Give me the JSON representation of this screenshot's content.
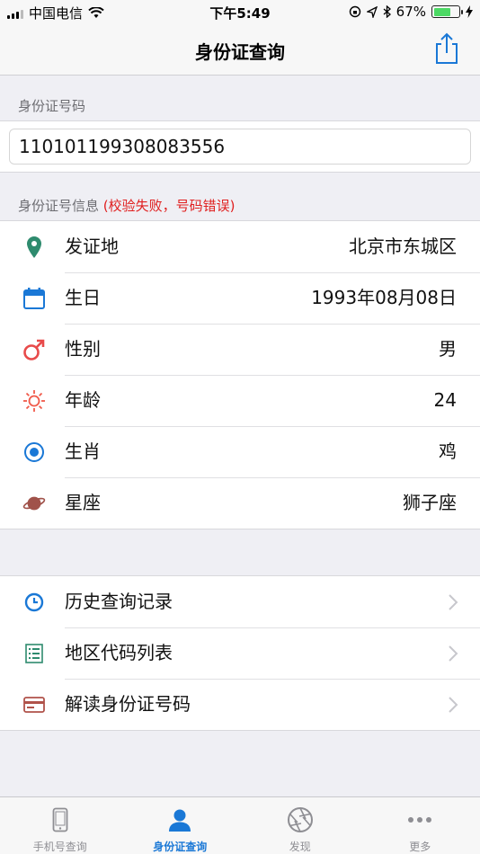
{
  "status": {
    "carrier": "中国电信",
    "time": "下午5:49",
    "battery": "67%",
    "battery_level": 0.67
  },
  "nav": {
    "title": "身份证查询"
  },
  "id_section": {
    "header": "身份证号码",
    "value": "110101199308083556"
  },
  "info_section": {
    "header": "身份证号信息",
    "error": "(校验失败，号码错误)",
    "rows": [
      {
        "label": "发证地",
        "value": "北京市东城区",
        "icon": "location-pin-icon",
        "color": "#2e8b6e"
      },
      {
        "label": "生日",
        "value": "1993年08月08日",
        "icon": "calendar-icon",
        "color": "#1a78d6"
      },
      {
        "label": "性别",
        "value": "男",
        "icon": "male-icon",
        "color": "#e84a4a"
      },
      {
        "label": "年龄",
        "value": "24",
        "icon": "sun-icon",
        "color": "#f05a4a"
      },
      {
        "label": "生肖",
        "value": "鸡",
        "icon": "zodiac-target-icon",
        "color": "#1a78d6"
      },
      {
        "label": "星座",
        "value": "狮子座",
        "icon": "planet-icon",
        "color": "#a0524a"
      }
    ]
  },
  "menu_section": {
    "rows": [
      {
        "label": "历史查询记录",
        "icon": "clock-icon",
        "color": "#1a78d6"
      },
      {
        "label": "地区代码列表",
        "icon": "list-icon",
        "color": "#2e8b6e"
      },
      {
        "label": "解读身份证号码",
        "icon": "id-card-icon",
        "color": "#b0524a"
      }
    ]
  },
  "tabs": [
    {
      "label": "手机号查询",
      "icon": "phone-icon",
      "active": false
    },
    {
      "label": "身份证查询",
      "icon": "person-icon",
      "active": true
    },
    {
      "label": "发现",
      "icon": "aperture-icon",
      "active": false
    },
    {
      "label": "更多",
      "icon": "more-dots-icon",
      "active": false
    }
  ],
  "colors": {
    "accent": "#1a78d6",
    "error": "#e02020",
    "background": "#efeff4"
  }
}
